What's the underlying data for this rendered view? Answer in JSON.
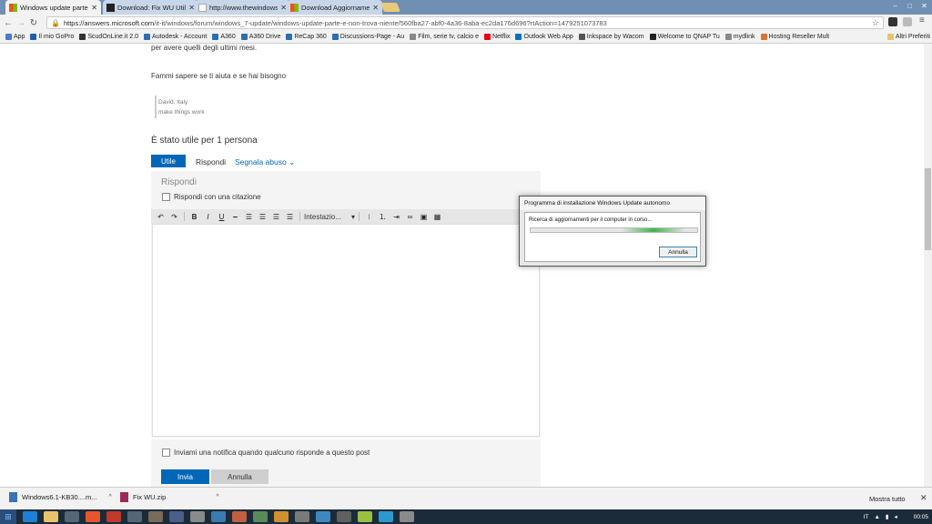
{
  "tabs": [
    {
      "title": "Windows update parte e",
      "active": true,
      "favicon_color": "#f25022"
    },
    {
      "title": "Download: Fix WU Utility",
      "active": false,
      "favicon_color": "#222222"
    },
    {
      "title": "http://www.thewindows",
      "active": false,
      "favicon_color": "#cccccc"
    },
    {
      "title": "Download Aggiornamen",
      "active": false,
      "favicon_color": "#f25022"
    }
  ],
  "address": {
    "host": "https://answers.microsoft.com",
    "path": "/it-it/windows/forum/windows_7-update/windows-update-parte-e-non-trova-niente/560fba27-abf0-4a36-8aba-ec2da176d696?rtAction=1479251073783"
  },
  "bookmarks": [
    {
      "label": "App",
      "color": "#4a7bd0"
    },
    {
      "label": "Il mio GoPro",
      "color": "#1a5fb4"
    },
    {
      "label": "ScudOnLine.it 2.0",
      "color": "#333333"
    },
    {
      "label": "Autodesk - Account",
      "color": "#2a6fb0"
    },
    {
      "label": "A360",
      "color": "#2a6fb0"
    },
    {
      "label": "A360 Drive",
      "color": "#2a6fb0"
    },
    {
      "label": "ReCap 360",
      "color": "#2a6fb0"
    },
    {
      "label": "Discussions-Page - Au",
      "color": "#2a6fb0"
    },
    {
      "label": "Film, serie tv, calcio e",
      "color": "#888888"
    },
    {
      "label": "Netflix",
      "color": "#e50914"
    },
    {
      "label": "Outlook Web App",
      "color": "#0072c6"
    },
    {
      "label": "Inkspace by Wacom",
      "color": "#555555"
    },
    {
      "label": "Welcome to QNAP Tu",
      "color": "#222222"
    },
    {
      "label": "mydlink",
      "color": "#888888"
    },
    {
      "label": "Hosting Reseller Mult",
      "color": "#e07030"
    }
  ],
  "other_bookmarks": "Altri Preferiti",
  "content": {
    "line1": "per avere quelli degli ultimi mesi.",
    "line2": "Fammi sapere se ti aiuta e se hai bisogno",
    "sig_name": "David, Italy",
    "sig_tag": "make things work",
    "helpful": "È stato utile per 1 persona",
    "btn_utile": "Utile",
    "btn_rispondi": "Rispondi",
    "btn_abuse": "Segnala abuso",
    "reply_title": "Rispondi",
    "quote_label": "Rispondi con una citazione",
    "heading_select": "Intestazio...",
    "notify_label": "Inviami una notifica quando qualcuno risponde a questo post",
    "btn_invia": "Invia",
    "btn_annulla": "Annulla"
  },
  "dialog": {
    "title": "Programma di installazione Windows Update autonomo",
    "status": "Ricerca di aggiornamenti per il computer in corso...",
    "button": "Annulla"
  },
  "downloads": {
    "items": [
      {
        "name": "Windows6.1-KB30....m...",
        "color": "#3b73b9"
      },
      {
        "name": "Fix WU.zip",
        "color": "#9b2a5a"
      }
    ],
    "show_all": "Mostra tutto"
  },
  "taskbar": {
    "lang": "IT",
    "time": "00:05"
  }
}
